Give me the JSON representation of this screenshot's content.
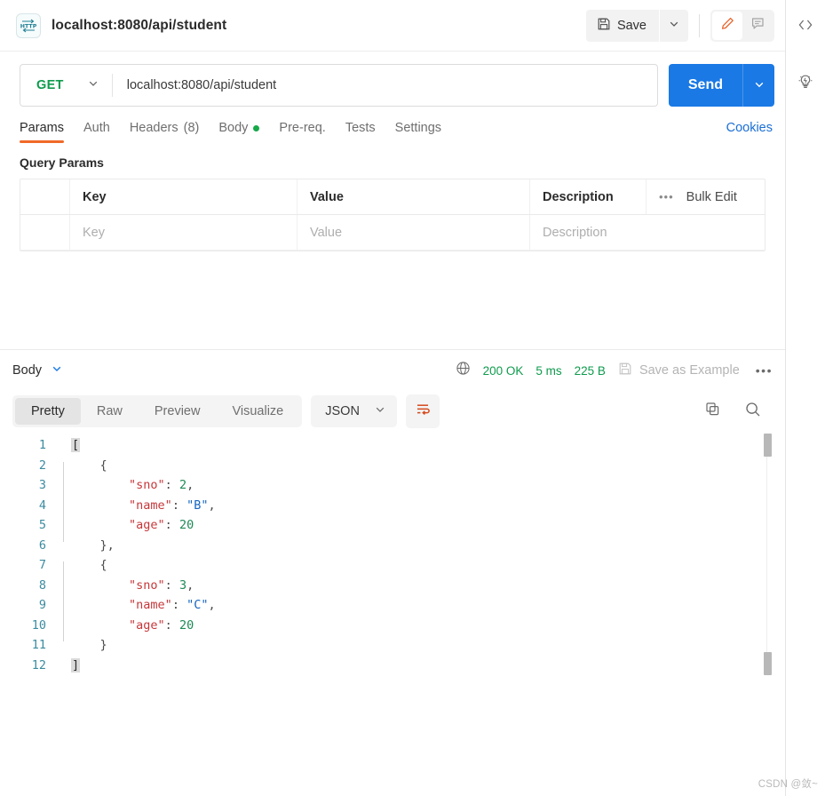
{
  "header": {
    "protocol_badge": "HTTP",
    "title": "localhost:8080/api/student",
    "save_label": "Save",
    "save_icon": "floppy-disk-icon",
    "save_caret_icon": "chevron-down-icon",
    "edit_icon": "pencil-icon",
    "comment_icon": "comment-icon"
  },
  "request": {
    "method": "GET",
    "method_caret_icon": "chevron-down-icon",
    "url": "localhost:8080/api/student",
    "send_label": "Send",
    "send_caret_icon": "chevron-down-icon"
  },
  "tabs": [
    {
      "label": "Params",
      "active": true
    },
    {
      "label": "Auth",
      "active": false
    },
    {
      "label": "Headers",
      "count": "(8)",
      "active": false
    },
    {
      "label": "Body",
      "dot": true,
      "active": false
    },
    {
      "label": "Pre-req.",
      "active": false
    },
    {
      "label": "Tests",
      "active": false
    },
    {
      "label": "Settings",
      "active": false
    }
  ],
  "cookies_label": "Cookies",
  "query_params": {
    "section_title": "Query Params",
    "columns": [
      "Key",
      "Value",
      "Description"
    ],
    "bulk_edit_label": "Bulk Edit",
    "more_icon": "ellipsis-icon",
    "rows": [
      {
        "key": "Key",
        "value": "Value",
        "description": "Description"
      }
    ]
  },
  "response": {
    "body_label": "Body",
    "body_caret_icon": "chevron-down-icon",
    "globe_icon": "globe-icon",
    "status": "200 OK",
    "time": "5 ms",
    "size": "225 B",
    "save_example_label": "Save as Example",
    "save_example_icon": "floppy-disk-icon",
    "more_icon": "ellipsis-icon",
    "view_tabs": [
      {
        "label": "Pretty",
        "active": true
      },
      {
        "label": "Raw",
        "active": false
      },
      {
        "label": "Preview",
        "active": false
      },
      {
        "label": "Visualize",
        "active": false
      }
    ],
    "format": "JSON",
    "format_caret_icon": "chevron-down-icon",
    "wrap_icon": "word-wrap-icon",
    "copy_icon": "copy-icon",
    "search_icon": "search-icon",
    "body_lines": [
      {
        "n": "1",
        "indent": 0,
        "tokens": [
          {
            "t": "bracket",
            "v": "["
          }
        ]
      },
      {
        "n": "2",
        "indent": 1,
        "tokens": [
          {
            "t": "p",
            "v": "{"
          }
        ]
      },
      {
        "n": "3",
        "indent": 2,
        "tokens": [
          {
            "t": "key",
            "v": "\"sno\""
          },
          {
            "t": "p",
            "v": ": "
          },
          {
            "t": "num",
            "v": "2"
          },
          {
            "t": "p",
            "v": ","
          }
        ]
      },
      {
        "n": "4",
        "indent": 2,
        "tokens": [
          {
            "t": "key",
            "v": "\"name\""
          },
          {
            "t": "p",
            "v": ": "
          },
          {
            "t": "str",
            "v": "\"B\""
          },
          {
            "t": "p",
            "v": ","
          }
        ]
      },
      {
        "n": "5",
        "indent": 2,
        "tokens": [
          {
            "t": "key",
            "v": "\"age\""
          },
          {
            "t": "p",
            "v": ": "
          },
          {
            "t": "num",
            "v": "20"
          }
        ]
      },
      {
        "n": "6",
        "indent": 1,
        "tokens": [
          {
            "t": "p",
            "v": "},"
          }
        ]
      },
      {
        "n": "7",
        "indent": 1,
        "tokens": [
          {
            "t": "p",
            "v": "{"
          }
        ]
      },
      {
        "n": "8",
        "indent": 2,
        "tokens": [
          {
            "t": "key",
            "v": "\"sno\""
          },
          {
            "t": "p",
            "v": ": "
          },
          {
            "t": "num",
            "v": "3"
          },
          {
            "t": "p",
            "v": ","
          }
        ]
      },
      {
        "n": "9",
        "indent": 2,
        "tokens": [
          {
            "t": "key",
            "v": "\"name\""
          },
          {
            "t": "p",
            "v": ": "
          },
          {
            "t": "str",
            "v": "\"C\""
          },
          {
            "t": "p",
            "v": ","
          }
        ]
      },
      {
        "n": "10",
        "indent": 2,
        "tokens": [
          {
            "t": "key",
            "v": "\"age\""
          },
          {
            "t": "p",
            "v": ": "
          },
          {
            "t": "num",
            "v": "20"
          }
        ]
      },
      {
        "n": "11",
        "indent": 1,
        "tokens": [
          {
            "t": "p",
            "v": "}"
          }
        ]
      },
      {
        "n": "12",
        "indent": 0,
        "tokens": [
          {
            "t": "bracket",
            "v": "]"
          }
        ]
      }
    ]
  },
  "right_rail": [
    {
      "icon": "code-icon"
    },
    {
      "icon": "lightbulb-icon"
    }
  ],
  "watermark": "CSDN @敛~",
  "colors": {
    "accent_orange": "#f06a28",
    "send_blue": "#1a79e5",
    "link_blue": "#1a6fd4",
    "status_green": "#0f9b4d",
    "method_green": "#0f9b4d",
    "json_key": "#c6373a",
    "json_string": "#1565c0",
    "json_number": "#1e8a55",
    "gutter": "#3c8ba0"
  }
}
